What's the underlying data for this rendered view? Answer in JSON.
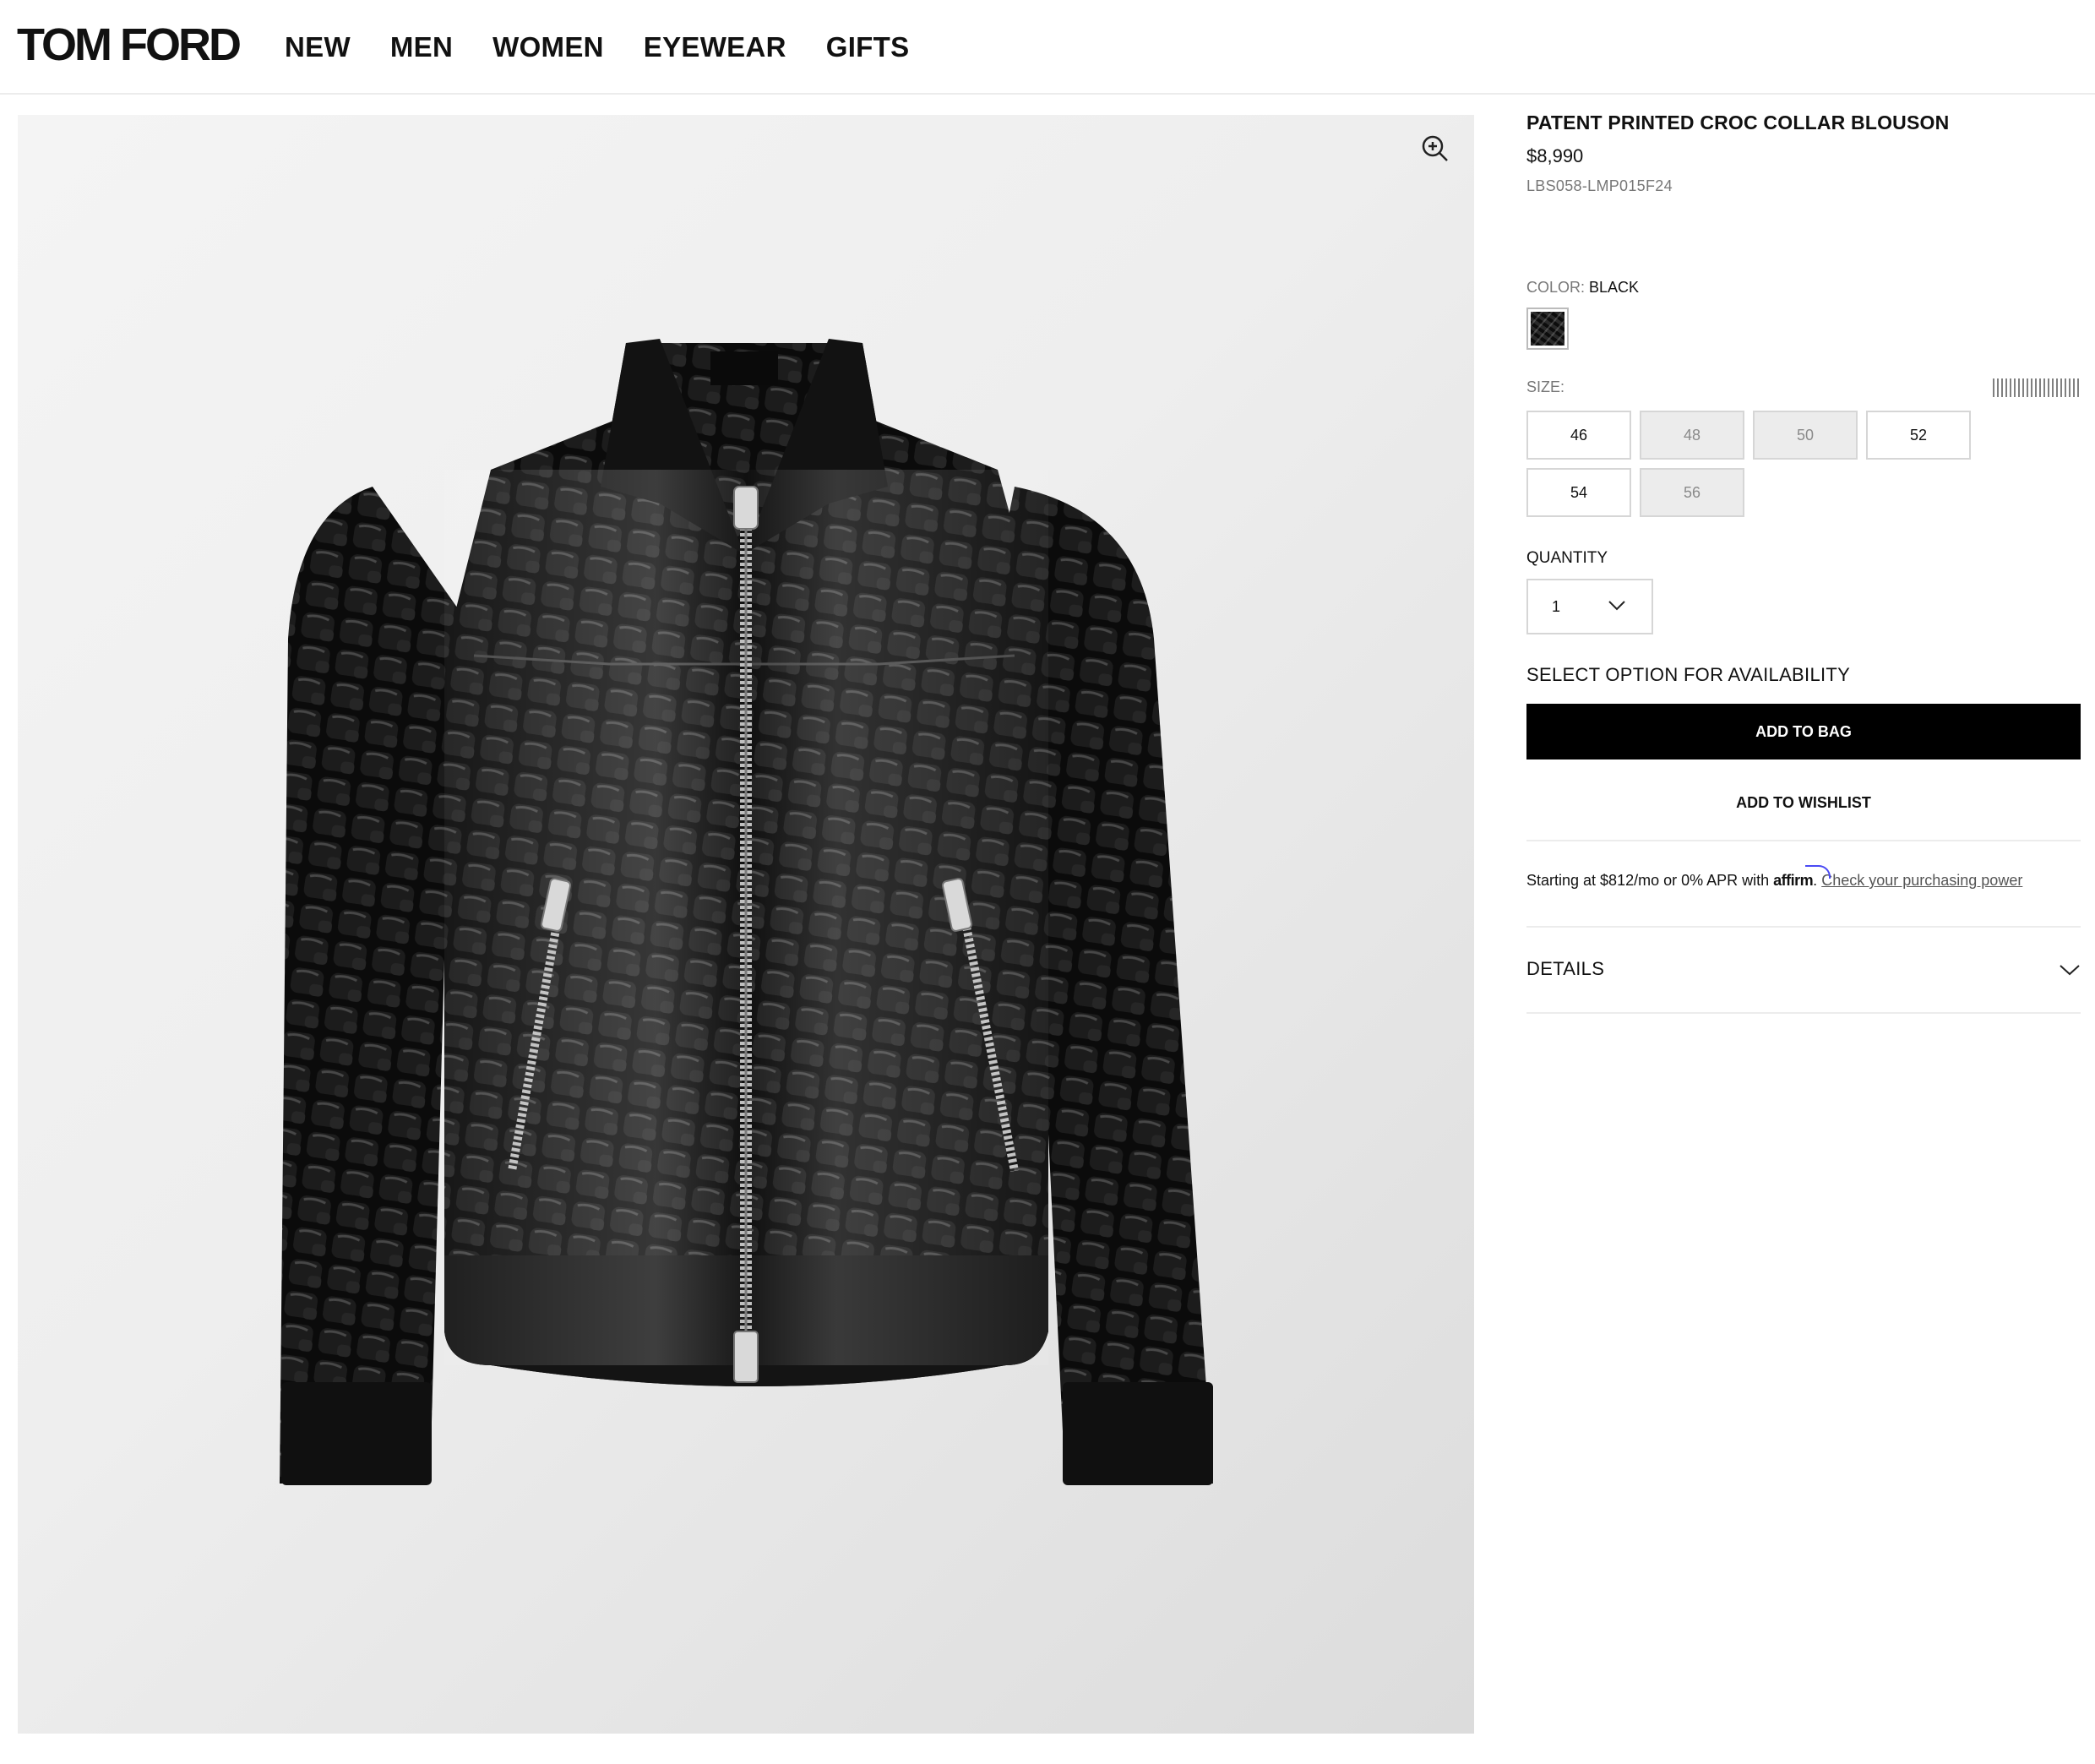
{
  "header": {
    "logo": "TOM FORD",
    "nav": [
      "NEW",
      "MEN",
      "WOMEN",
      "EYEWEAR",
      "GIFTS"
    ]
  },
  "gallery": {
    "zoom_icon": "zoom-in-icon",
    "image_alt": "Black patent croc-embossed collared zip jacket"
  },
  "product": {
    "title": "PATENT PRINTED CROC COLLAR BLOUSON",
    "price": "$8,990",
    "sku": "LBS058-LMP015F24",
    "color_label": "COLOR:",
    "color_value": "BLACK",
    "size_label": "SIZE:",
    "sizes": [
      {
        "label": "46",
        "available": true
      },
      {
        "label": "48",
        "available": false
      },
      {
        "label": "50",
        "available": false
      },
      {
        "label": "52",
        "available": true
      },
      {
        "label": "54",
        "available": true
      },
      {
        "label": "56",
        "available": false
      }
    ],
    "quantity_label": "QUANTITY",
    "quantity_value": "1",
    "availability_text": "SELECT OPTION FOR AVAILABILITY",
    "add_to_bag": "ADD TO BAG",
    "add_to_wishlist": "ADD TO WISHLIST",
    "affirm": {
      "prefix": "Starting at $812/mo or 0% APR with ",
      "brand": "affirm",
      "period": ".",
      "link": "Check your purchasing power"
    },
    "details_label": "DETAILS"
  },
  "colors": {
    "accent": "#000000",
    "affirm_blue": "#4a4af4",
    "disabled_bg": "#ececec"
  }
}
